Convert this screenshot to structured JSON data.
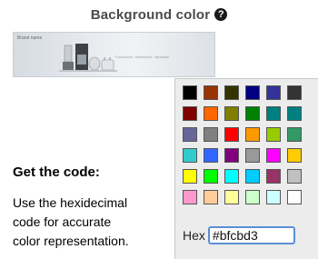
{
  "header": {
    "title": "Background color",
    "help_icon": "question-mark-icon"
  },
  "banner": {
    "logo_text": "Brand name",
    "tagline": "Functional · Affordable · Beautiful"
  },
  "info": {
    "title": "Get the code:",
    "description_lines": [
      "Use the hexidecimal",
      "code for accurate",
      "color representation."
    ]
  },
  "palette": {
    "swatches": [
      "#000000",
      "#993300",
      "#333300",
      "#000080",
      "#333399",
      "#333333",
      "#800000",
      "#ff6600",
      "#808000",
      "#008000",
      "#008080",
      "#008080",
      "#666699",
      "#808080",
      "#ff0000",
      "#ff9900",
      "#99cc00",
      "#339966",
      "#33cccc",
      "#3366ff",
      "#800080",
      "#999999",
      "#ff00ff",
      "#ffcc00",
      "#ffff00",
      "#00ff00",
      "#00ffff",
      "#00ccff",
      "#993366",
      "#c0c0c0",
      "#ff99cc",
      "#ffcc99",
      "#ffff99",
      "#ccffcc",
      "#ccffff",
      "#ffffff"
    ],
    "hex_label": "Hex",
    "hex_value": "#bfcbd3"
  }
}
